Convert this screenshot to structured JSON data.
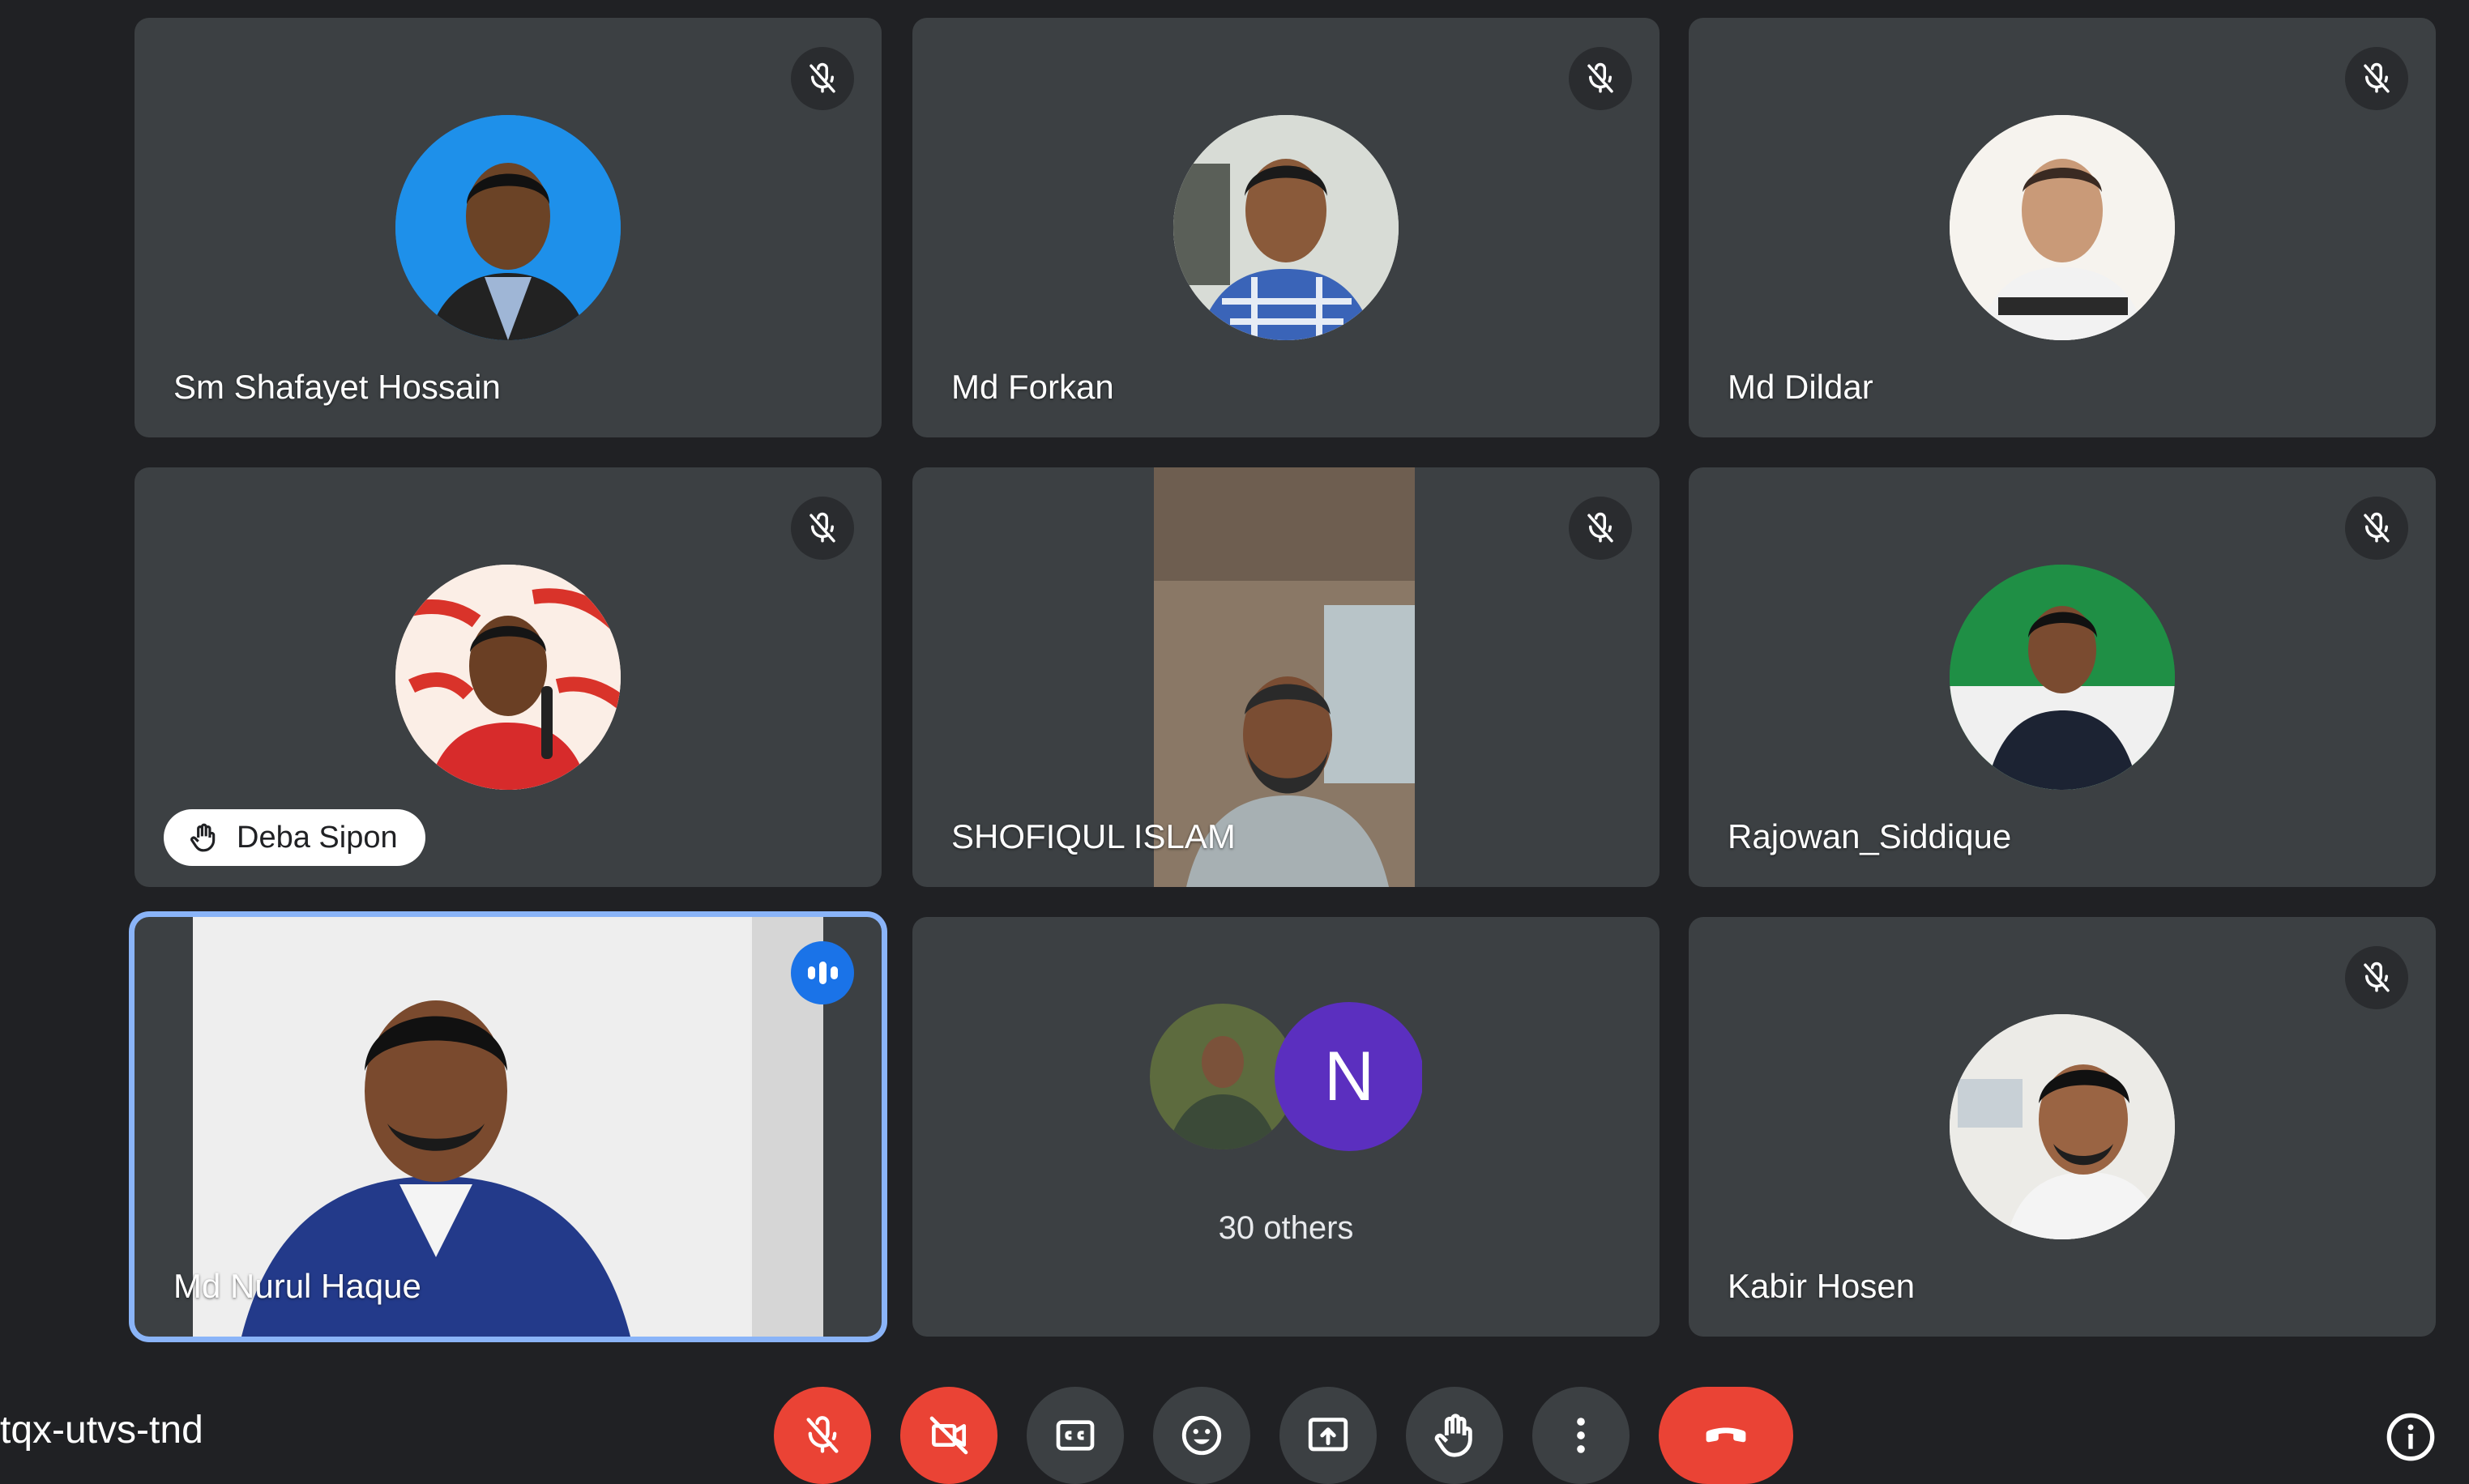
{
  "participants": [
    {
      "name": "Sm Shafayet Hossain"
    },
    {
      "name": "Md Forkan"
    },
    {
      "name": "Md Dildar"
    },
    {
      "name": "Deba Sipon"
    },
    {
      "name": "SHOFIQUL ISLAM"
    },
    {
      "name": "Rajowan_Siddique"
    },
    {
      "name": "Md Nurul Haque"
    },
    {
      "name": "Kabir Hosen"
    }
  ],
  "others": {
    "initial": "N",
    "label": "30 others"
  },
  "meeting": {
    "code": "tqx-utvs-tnd"
  },
  "colors": {
    "background": "#202124",
    "tile": "#3c4043",
    "danger": "#ea4335",
    "speaking": "#8ab4f8",
    "others_avatar": "#5b2fbf"
  },
  "controls": [
    "mic-off-icon",
    "camera-off-icon",
    "captions-icon",
    "emoji-icon",
    "present-icon",
    "raise-hand-icon",
    "more-options-icon",
    "end-call-icon"
  ]
}
